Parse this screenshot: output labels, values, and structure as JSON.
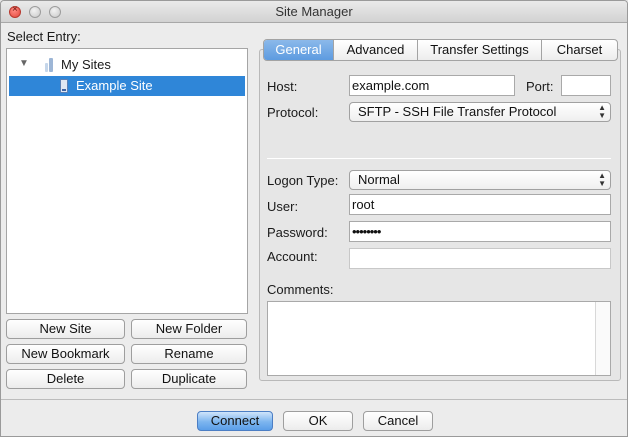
{
  "window": {
    "title": "Site Manager"
  },
  "left": {
    "select_entry_label": "Select Entry:",
    "tree": [
      {
        "label": "My Sites",
        "icon": "folder-icon",
        "expanded": true
      },
      {
        "label": "Example Site",
        "icon": "server-icon",
        "selected": true
      }
    ],
    "buttons": {
      "new_site": "New Site",
      "new_folder": "New Folder",
      "new_bookmark": "New Bookmark",
      "rename": "Rename",
      "delete": "Delete",
      "duplicate": "Duplicate"
    }
  },
  "tabs": [
    {
      "label": "General",
      "active": true
    },
    {
      "label": "Advanced"
    },
    {
      "label": "Transfer Settings"
    },
    {
      "label": "Charset"
    }
  ],
  "general": {
    "host_label": "Host:",
    "host_value": "example.com",
    "port_label": "Port:",
    "port_value": "",
    "protocol_label": "Protocol:",
    "protocol_value": "SFTP - SSH File Transfer Protocol",
    "logon_type_label": "Logon Type:",
    "logon_type_value": "Normal",
    "user_label": "User:",
    "user_value": "root",
    "password_label": "Password:",
    "password_value": "••••••••",
    "account_label": "Account:",
    "account_value": "",
    "comments_label": "Comments:"
  },
  "footer": {
    "connect": "Connect",
    "ok": "OK",
    "cancel": "Cancel"
  },
  "colors": {
    "selection": "#2f86d8",
    "active_tab": "#5d9be0",
    "default_button": "#7cb5ef"
  }
}
